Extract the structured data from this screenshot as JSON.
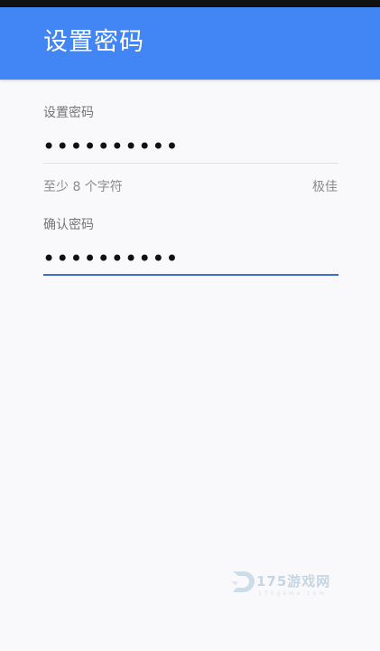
{
  "app_bar": {
    "title": "设置密码"
  },
  "form": {
    "password": {
      "label": "设置密码",
      "value": "••••••••••",
      "hint_left": "至少 8 个字符",
      "hint_right": "极佳"
    },
    "confirm": {
      "label": "确认密码",
      "value": "••••••••••"
    }
  },
  "watermark": {
    "text": "175游戏网",
    "sub": "175game.com"
  },
  "colors": {
    "app_bar": "#4285f4",
    "active_underline": "#3f6fc4",
    "background": "#f9f9fb"
  }
}
